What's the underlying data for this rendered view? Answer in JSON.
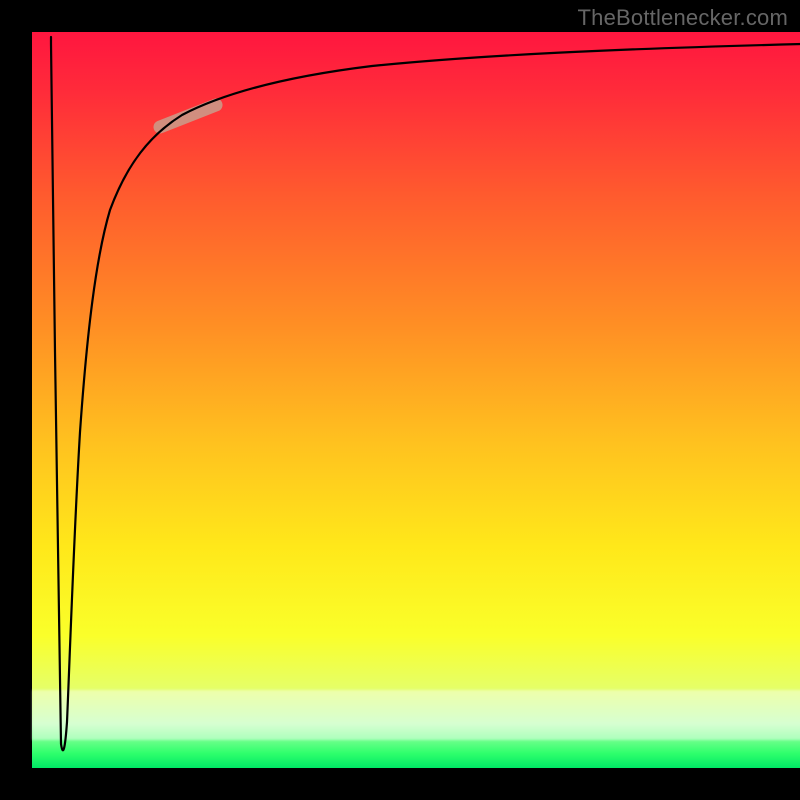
{
  "watermark": "TheBottlenecker.com",
  "chart_data": {
    "type": "line",
    "title": "",
    "xlabel": "",
    "ylabel": "",
    "xlim": [
      0,
      100
    ],
    "ylim": [
      0,
      100
    ],
    "x": [
      0,
      0.5,
      1,
      1.5,
      2,
      3,
      4,
      6,
      8,
      12,
      18,
      25,
      35,
      50,
      70,
      100
    ],
    "values": [
      100,
      60,
      5,
      25,
      50,
      65,
      73,
      80,
      84,
      88,
      90.5,
      92.3,
      93.6,
      94.8,
      95.6,
      96.3
    ],
    "highlight_range_x": [
      16,
      25
    ],
    "background_gradient": [
      "#ff163f",
      "#ff8f24",
      "#ffe81a",
      "#00e865"
    ],
    "grid": false,
    "legend": false
  }
}
